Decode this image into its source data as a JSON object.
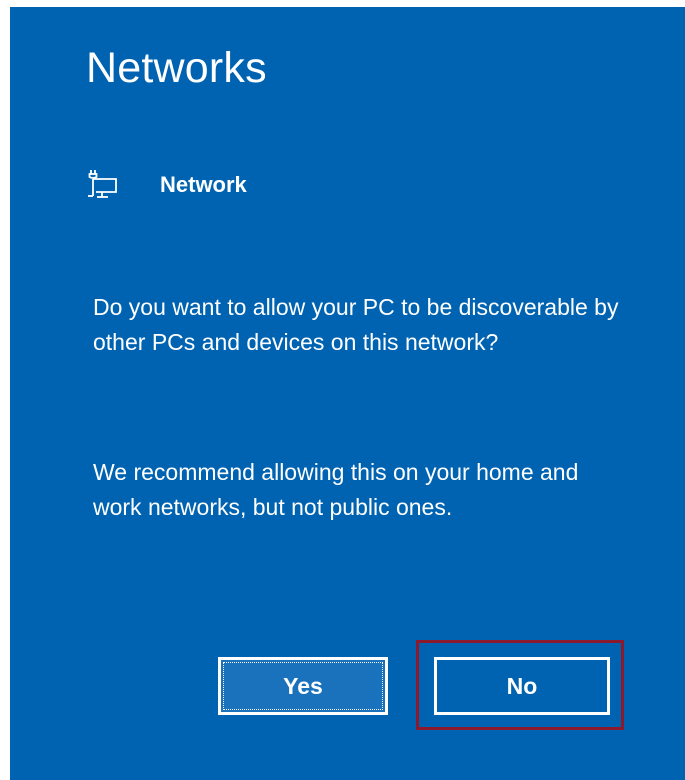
{
  "dialog": {
    "title": "Networks",
    "network_name": "Network",
    "network_icon": "wired-network-pc-icon",
    "prompt_text": "Do you want to allow your PC to be discoverable by other PCs and devices on this network?",
    "recommendation_text": "We recommend allowing this on your home and work networks, but not public ones.",
    "yes_label": "Yes",
    "no_label": "No"
  },
  "colors": {
    "background": "#0063b1",
    "text": "#ffffff",
    "highlight_border": "#8b1a2e"
  }
}
